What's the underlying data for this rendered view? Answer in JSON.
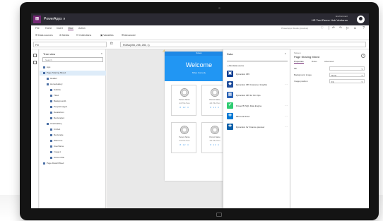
{
  "titlebar": {
    "app_name": "PowerApps ∨",
    "env_label": "Environment",
    "env_name": "HR Test Demo Hub Ventures",
    "logo_letter": "⊞"
  },
  "menu": {
    "items": [
      "File",
      "Home",
      "Insert",
      "View",
      "Action"
    ],
    "active_index": 3,
    "right_label": "PowerApps Studio (preview)",
    "quick_actions": [
      "♡",
      "|",
      "↶",
      "↷",
      "▷",
      "☺",
      "?"
    ]
  },
  "ribbon": {
    "items": [
      "☰ Data sources",
      "⚙ Media",
      "☷ Collections",
      "▣ Variables",
      "☰ Advanced"
    ]
  },
  "formula_bar": {
    "property": "Fill",
    "fx": "fx",
    "expression": "RGBA(255, 255, 255, 1)"
  },
  "tree_view": {
    "title": "Tree view",
    "close": "×",
    "search_placeholder": "Search",
    "rows": [
      {
        "label": "App",
        "indent": 0,
        "selected": false
      },
      {
        "label": "Page Sharing Mixed",
        "indent": 0,
        "selected": true
      },
      {
        "label": "Header",
        "indent": 1,
        "selected": false
      },
      {
        "label": "HomeGallery",
        "indent": 1,
        "selected": false
      },
      {
        "label": "Subtitle",
        "indent": 2,
        "selected": false
      },
      {
        "label": "Title2",
        "indent": 2,
        "selected": false
      },
      {
        "label": "Background1",
        "indent": 2,
        "selected": false
      },
      {
        "label": "PeopleImage1",
        "indent": 2,
        "selected": false
      },
      {
        "label": "DetailsIcon",
        "indent": 2,
        "selected": false
      },
      {
        "label": "Rectangle1",
        "indent": 2,
        "selected": false
      },
      {
        "label": "ChartGallery",
        "indent": 1,
        "selected": false
      },
      {
        "label": "Circle1",
        "indent": 2,
        "selected": false
      },
      {
        "label": "Rectangle",
        "indent": 2,
        "selected": false
      },
      {
        "label": "Welcome",
        "indent": 2,
        "selected": false
      },
      {
        "label": "UserName",
        "indent": 2,
        "selected": false
      },
      {
        "label": "Image1",
        "indent": 2,
        "selected": false
      },
      {
        "label": "ScreenTitle",
        "indent": 2,
        "selected": false
      },
      {
        "label": "Page Detail Mixed",
        "indent": 0,
        "selected": false
      }
    ]
  },
  "canvas": {
    "header_text": "Screen",
    "welcome": "Welcome",
    "user_name": "Miles Comedy",
    "cards": [
      {
        "title": "Person Name",
        "sub": "Job Title Here",
        "stats": "8 12 4"
      },
      {
        "title": "Person Name",
        "sub": "Job Title Here",
        "stats": "8 12 4"
      },
      {
        "title": "Person Name",
        "sub": "Job Title Here",
        "stats": "8 12 4"
      },
      {
        "title": "Person Name",
        "sub": "Job Title Here",
        "stats": "8 12 4"
      }
    ]
  },
  "data_panel": {
    "title": "Data",
    "close": "×",
    "add_label": "+ Add data source",
    "sources": [
      {
        "label": "Dynamics 365",
        "icon": "▣",
        "color": "#0b3d91",
        "more": ""
      },
      {
        "label": "Dynamics 365 Customer Insights",
        "icon": "◆",
        "color": "#1f4e9c",
        "more": "…"
      },
      {
        "label": "Dynamics 365 for Fin Ops",
        "icon": "▦",
        "color": "#2962b5",
        "more": ""
      },
      {
        "label": "Power BI SQL Data Engine",
        "icon": "✔",
        "color": "#2ecc71",
        "more": "…"
      },
      {
        "label": "Microsoft Flow",
        "icon": "✚",
        "color": "#0078d4",
        "more": "…"
      },
      {
        "label": "Dynamics for Finance preview",
        "icon": "✚",
        "color": "#0a5fa8",
        "more": "…"
      }
    ]
  },
  "properties": {
    "kind": "Screen",
    "name": "Page Sharing Mixed",
    "help": "?",
    "tabs": [
      "Properties",
      "Rules",
      "Advanced"
    ],
    "active_tab": 0,
    "rows": [
      {
        "label": "Fill",
        "value": "",
        "arrow": "▾"
      },
      {
        "label": "Background image",
        "value": "None",
        "arrow": "▾"
      },
      {
        "label": "Image position",
        "value": "Fit",
        "arrow": "▾"
      }
    ]
  },
  "colors": {
    "brand": "#742774",
    "accent": "#2196f3",
    "titlebar": "#2b2a33"
  }
}
